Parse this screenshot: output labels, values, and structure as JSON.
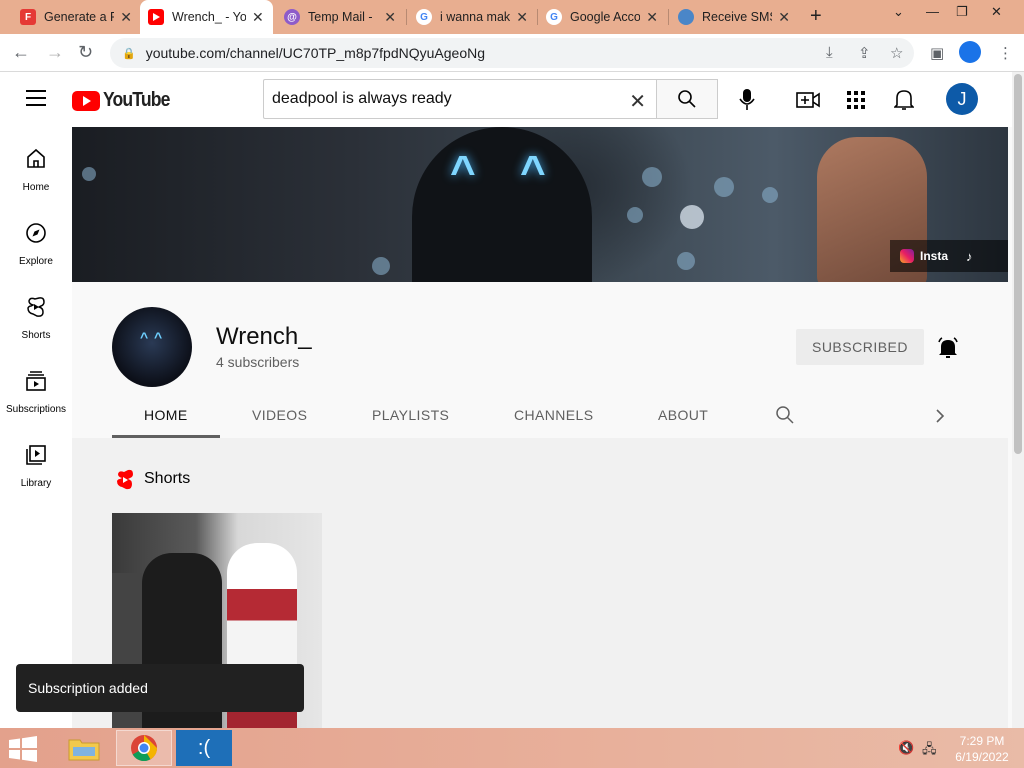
{
  "browser": {
    "tabs": [
      {
        "label": "Generate a P",
        "favicon": "F",
        "favicon_color": "#e53935"
      },
      {
        "label": "Wrench_ - Yo",
        "favicon": "yt",
        "favicon_color": "#ff0000",
        "active": true
      },
      {
        "label": "Temp Mail -",
        "favicon": "@",
        "favicon_color": "#8e5cc9"
      },
      {
        "label": "i wanna mak",
        "favicon": "G",
        "favicon_color": "#4285f4"
      },
      {
        "label": "Google Acco",
        "favicon": "G",
        "favicon_color": "#4285f4"
      },
      {
        "label": "Receive SMS",
        "favicon": "globe",
        "favicon_color": "#4a86c8"
      }
    ],
    "url": "youtube.com/channel/UC70TP_m8p7fpdNQyuAgeoNg"
  },
  "youtube": {
    "logo_text": "YouTube",
    "search_value": "deadpool is always ready",
    "avatar_letter": "J",
    "sidebar": [
      {
        "label": "Home",
        "icon": "home-icon"
      },
      {
        "label": "Explore",
        "icon": "compass-icon"
      },
      {
        "label": "Shorts",
        "icon": "shorts-icon"
      },
      {
        "label": "Subscriptions",
        "icon": "subscriptions-icon"
      },
      {
        "label": "Library",
        "icon": "library-icon"
      }
    ]
  },
  "banner": {
    "link_label": "Insta"
  },
  "channel": {
    "name": "Wrench_",
    "subscribers": "4 subscribers",
    "subscribe_label": "SUBSCRIBED",
    "tabs": [
      "HOME",
      "VIDEOS",
      "PLAYLISTS",
      "CHANNELS",
      "ABOUT"
    ],
    "active_tab": "HOME"
  },
  "content": {
    "section_title": "Shorts"
  },
  "toast": {
    "message": "Subscription added"
  },
  "taskbar": {
    "time": "7:29 PM",
    "date": "6/19/2022"
  },
  "colors": {
    "youtube_red": "#ff0000",
    "tabstrip": "#e8ae90",
    "avatar_blue": "#0d5aa8"
  }
}
